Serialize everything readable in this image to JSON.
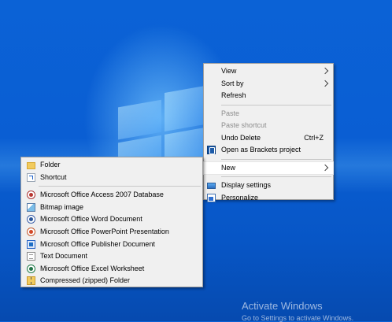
{
  "context_menu": {
    "items": [
      {
        "label": "View",
        "icon": "",
        "submenu": true,
        "disabled": false
      },
      {
        "label": "Sort by",
        "icon": "",
        "submenu": true,
        "disabled": false
      },
      {
        "label": "Refresh",
        "icon": "",
        "submenu": false,
        "disabled": false
      },
      {
        "label": "Paste",
        "icon": "",
        "submenu": false,
        "disabled": true
      },
      {
        "label": "Paste shortcut",
        "icon": "",
        "submenu": false,
        "disabled": true
      },
      {
        "label": "Undo Delete",
        "shortcut": "Ctrl+Z",
        "icon": "",
        "submenu": false,
        "disabled": false
      },
      {
        "label": "Open as Brackets project",
        "icon": "brackets-icon",
        "submenu": false,
        "disabled": false
      },
      {
        "label": "New",
        "icon": "",
        "submenu": true,
        "highlighted": true
      },
      {
        "label": "Display settings",
        "icon": "display-settings-icon",
        "submenu": false,
        "disabled": false
      },
      {
        "label": "Personalize",
        "icon": "personalize-icon",
        "submenu": false,
        "disabled": false
      }
    ]
  },
  "new_submenu": {
    "items": [
      {
        "label": "Folder",
        "icon": "folder-icon"
      },
      {
        "label": "Shortcut",
        "icon": "shortcut-icon"
      },
      {
        "label": "Microsoft Office Access 2007 Database",
        "icon": "access-icon"
      },
      {
        "label": "Bitmap image",
        "icon": "bitmap-icon"
      },
      {
        "label": "Microsoft Office Word Document",
        "icon": "word-icon"
      },
      {
        "label": "Microsoft Office PowerPoint Presentation",
        "icon": "powerpoint-icon"
      },
      {
        "label": "Microsoft Office Publisher Document",
        "icon": "publisher-icon"
      },
      {
        "label": "Text Document",
        "icon": "text-document-icon"
      },
      {
        "label": "Microsoft Office Excel Worksheet",
        "icon": "excel-icon"
      },
      {
        "label": "Compressed (zipped) Folder",
        "icon": "zip-folder-icon"
      }
    ]
  },
  "watermark": {
    "title": "Activate Windows",
    "subtitle": "Go to Settings to activate Windows."
  },
  "colors": {
    "desktop_blue": "#0a5ed3",
    "menu_background": "#f0f0f0",
    "disabled_text": "#8d8d8d"
  }
}
